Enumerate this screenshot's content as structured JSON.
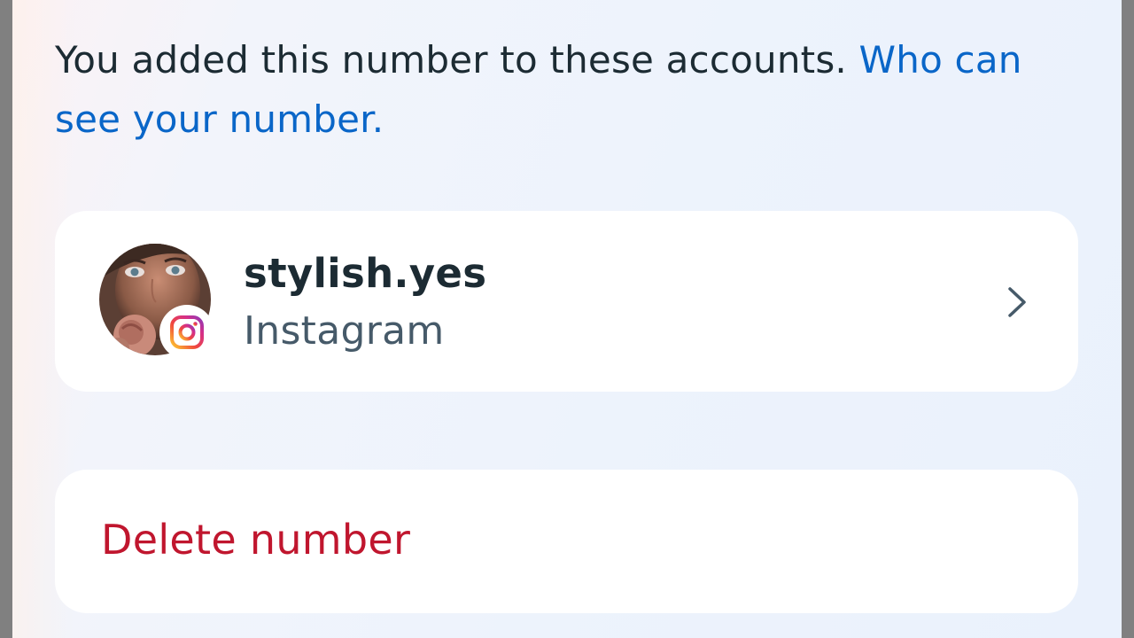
{
  "intro": {
    "text": "You added this number to these accounts.",
    "link": "Who can see your number."
  },
  "account": {
    "username": "stylish.yes",
    "platform": "Instagram",
    "avatar_icon": "profile-photo",
    "badge_icon": "instagram-icon",
    "chevron_icon": "chevron-right-icon"
  },
  "actions": {
    "delete_label": "Delete number"
  },
  "colors": {
    "link": "#0a66c8",
    "destructive": "#c0162e",
    "text": "#1c2b33",
    "secondary_text": "#465a69"
  }
}
